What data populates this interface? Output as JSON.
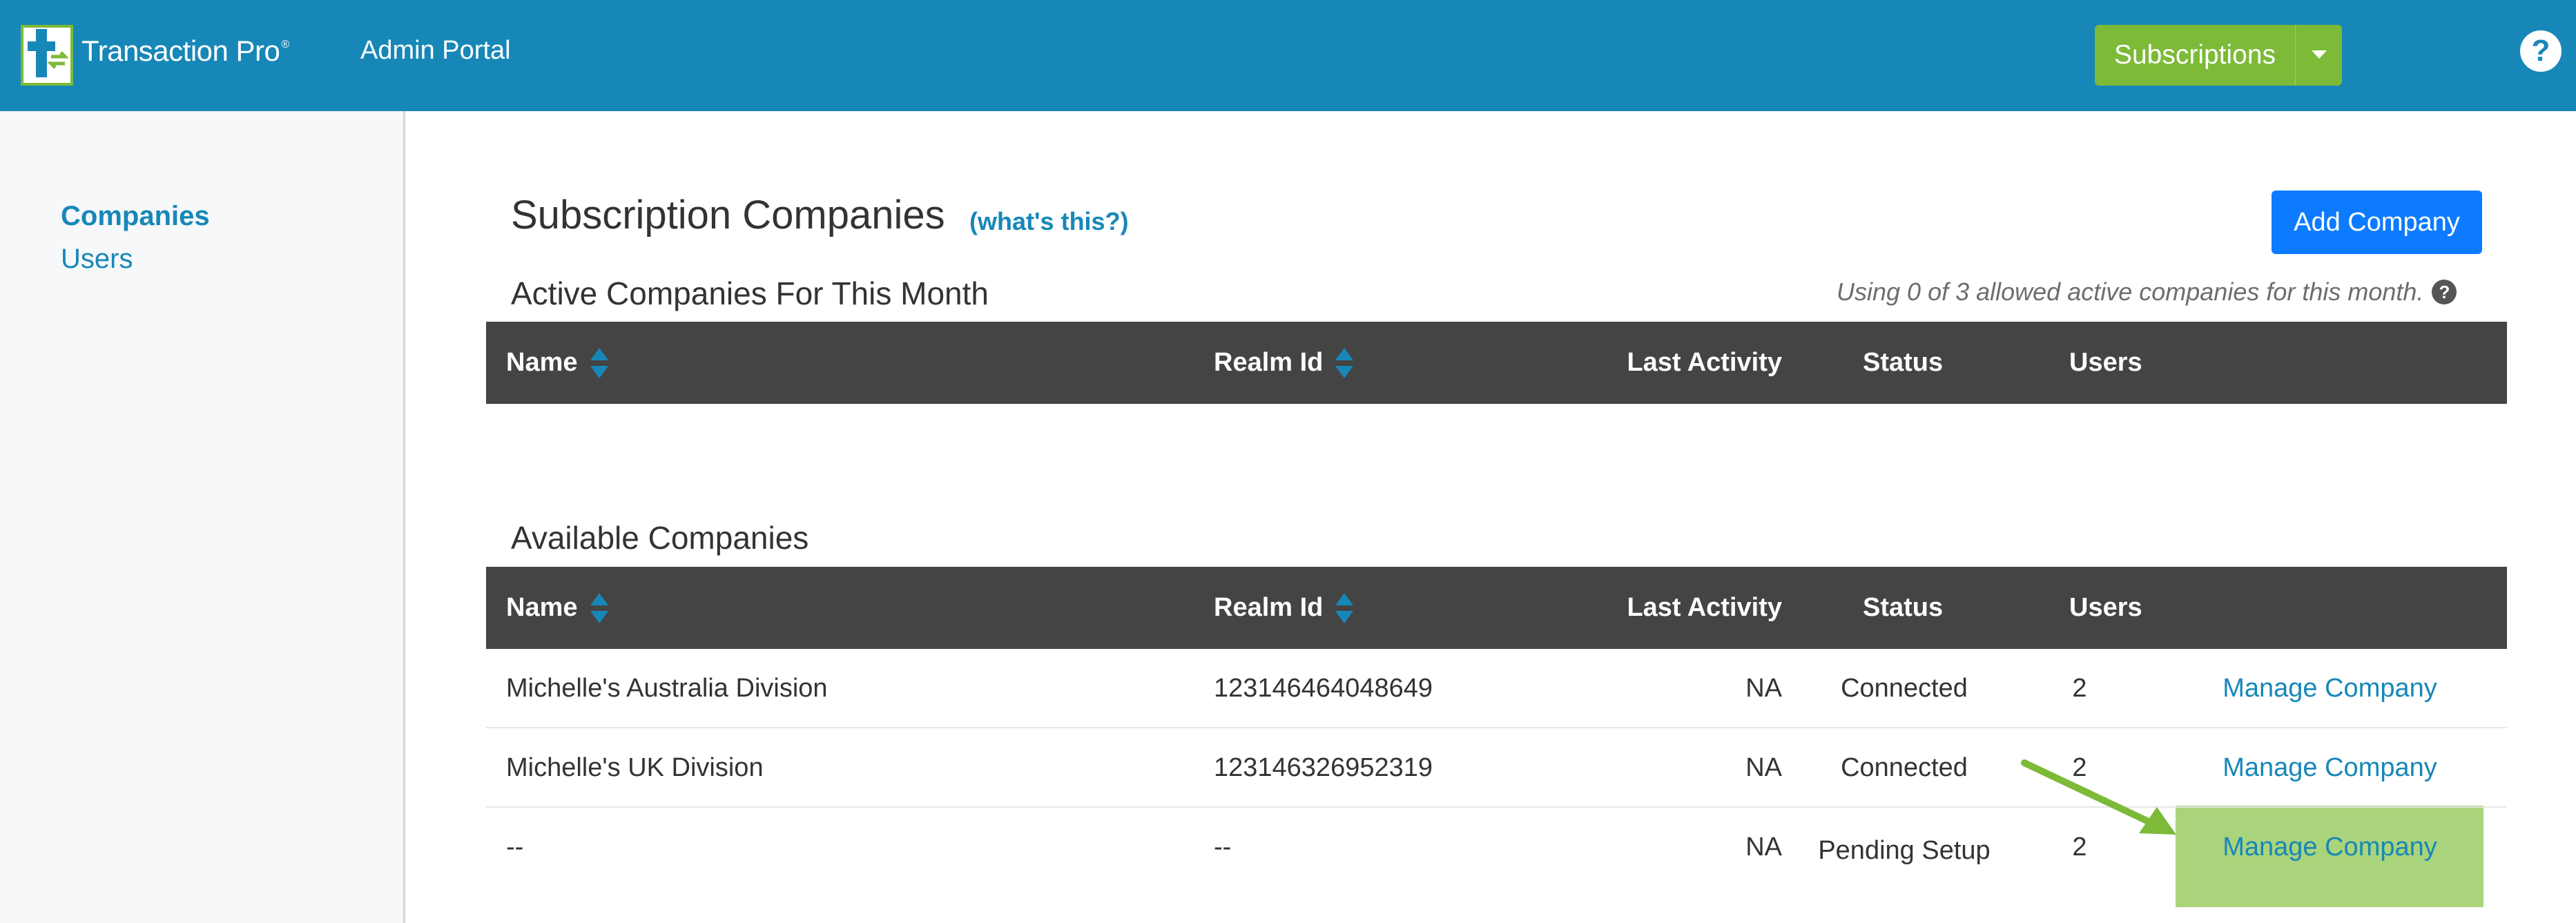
{
  "app": {
    "brand": "Transaction Pro",
    "brand_mark": "®",
    "portal_label": "Admin Portal",
    "subscriptions_label": "Subscriptions",
    "help_label": "?"
  },
  "sidebar": {
    "items": [
      {
        "label": "Companies",
        "active": true
      },
      {
        "label": "Users",
        "active": false
      }
    ]
  },
  "main": {
    "title": "Subscription Companies",
    "whats_this": "(what's this?)",
    "add_button": "Add Company",
    "active_section": {
      "title": "Active Companies For This Month",
      "usage_note": "Using 0 of 3 allowed active companies for this month.",
      "rows": []
    },
    "available_section": {
      "title": "Available Companies"
    },
    "columns": [
      "Name",
      "Realm Id",
      "Last Activity",
      "Status",
      "Users"
    ],
    "available_rows": [
      {
        "name": "Michelle's Australia Division",
        "realm_id": "123146464048649",
        "last_activity": "NA",
        "status": "Connected",
        "users": "2",
        "action": "Manage Company"
      },
      {
        "name": "Michelle's UK Division",
        "realm_id": "123146326952319",
        "last_activity": "NA",
        "status": "Connected",
        "users": "2",
        "action": "Manage Company"
      },
      {
        "name": "--",
        "realm_id": "--",
        "last_activity": "NA",
        "status": "Pending Setup",
        "users": "2",
        "action": "Manage Company"
      }
    ]
  },
  "colors": {
    "header": "#1787b8",
    "subscriptions_button": "#7cba38",
    "add_button": "#0d7bff",
    "table_header": "#444444",
    "link": "#1787b8",
    "highlight": "#a9d47b",
    "annotation_arrow": "#7cba38"
  },
  "icons": [
    "transaction-pro-logo-icon",
    "caret-down-icon",
    "help-icon",
    "sort-icon",
    "question-circle-icon",
    "annotation-arrow-icon"
  ]
}
